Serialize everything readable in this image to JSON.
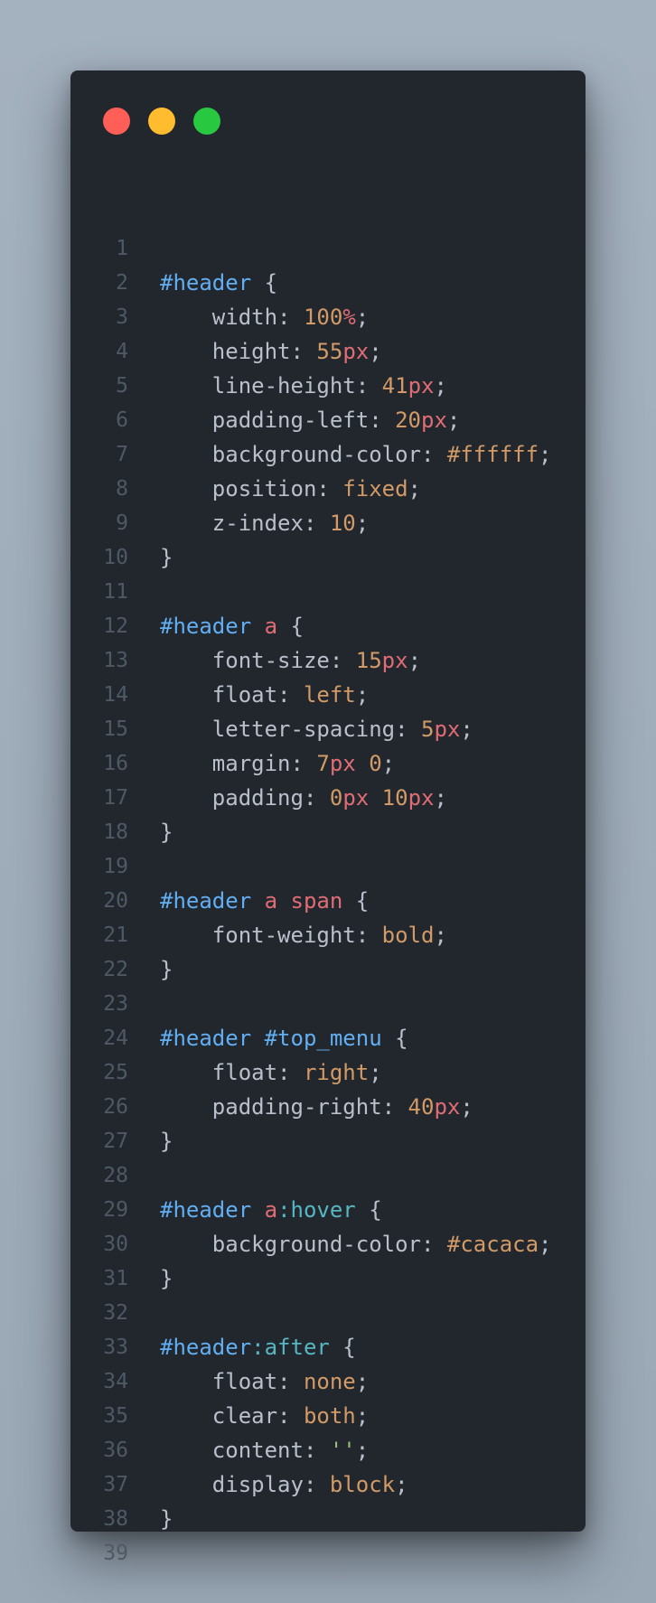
{
  "window": {
    "controls": [
      "close",
      "minimize",
      "maximize"
    ]
  },
  "code": {
    "lines": [
      {
        "n": "1",
        "tokens": []
      },
      {
        "n": "2",
        "tokens": [
          [
            "#header",
            "id"
          ],
          [
            " {",
            "punc"
          ]
        ]
      },
      {
        "n": "3",
        "tokens": [
          [
            "    ",
            "punc"
          ],
          [
            "width",
            "prop"
          ],
          [
            ": ",
            "punc"
          ],
          [
            "100",
            "num"
          ],
          [
            "%",
            "unit"
          ],
          [
            ";",
            "punc"
          ]
        ]
      },
      {
        "n": "4",
        "tokens": [
          [
            "    ",
            "punc"
          ],
          [
            "height",
            "prop"
          ],
          [
            ": ",
            "punc"
          ],
          [
            "55",
            "num"
          ],
          [
            "px",
            "unit"
          ],
          [
            ";",
            "punc"
          ]
        ]
      },
      {
        "n": "5",
        "tokens": [
          [
            "    ",
            "punc"
          ],
          [
            "line-height",
            "prop"
          ],
          [
            ": ",
            "punc"
          ],
          [
            "41",
            "num"
          ],
          [
            "px",
            "unit"
          ],
          [
            ";",
            "punc"
          ]
        ]
      },
      {
        "n": "6",
        "tokens": [
          [
            "    ",
            "punc"
          ],
          [
            "padding-left",
            "prop"
          ],
          [
            ": ",
            "punc"
          ],
          [
            "20",
            "num"
          ],
          [
            "px",
            "unit"
          ],
          [
            ";",
            "punc"
          ]
        ]
      },
      {
        "n": "7",
        "tokens": [
          [
            "    ",
            "punc"
          ],
          [
            "background-color",
            "prop"
          ],
          [
            ": ",
            "punc"
          ],
          [
            "#ffffff",
            "kw"
          ],
          [
            ";",
            "punc"
          ]
        ]
      },
      {
        "n": "8",
        "tokens": [
          [
            "    ",
            "punc"
          ],
          [
            "position",
            "prop"
          ],
          [
            ": ",
            "punc"
          ],
          [
            "fixed",
            "kw"
          ],
          [
            ";",
            "punc"
          ]
        ]
      },
      {
        "n": "9",
        "tokens": [
          [
            "    ",
            "punc"
          ],
          [
            "z-index",
            "prop"
          ],
          [
            ": ",
            "punc"
          ],
          [
            "10",
            "num"
          ],
          [
            ";",
            "punc"
          ]
        ]
      },
      {
        "n": "10",
        "tokens": [
          [
            "}",
            "punc"
          ]
        ]
      },
      {
        "n": "11",
        "tokens": []
      },
      {
        "n": "12",
        "tokens": [
          [
            "#header",
            "id"
          ],
          [
            " ",
            "punc"
          ],
          [
            "a",
            "tag"
          ],
          [
            " {",
            "punc"
          ]
        ]
      },
      {
        "n": "13",
        "tokens": [
          [
            "    ",
            "punc"
          ],
          [
            "font-size",
            "prop"
          ],
          [
            ": ",
            "punc"
          ],
          [
            "15",
            "num"
          ],
          [
            "px",
            "unit"
          ],
          [
            ";",
            "punc"
          ]
        ]
      },
      {
        "n": "14",
        "tokens": [
          [
            "    ",
            "punc"
          ],
          [
            "float",
            "prop"
          ],
          [
            ": ",
            "punc"
          ],
          [
            "left",
            "kw"
          ],
          [
            ";",
            "punc"
          ]
        ]
      },
      {
        "n": "15",
        "tokens": [
          [
            "    ",
            "punc"
          ],
          [
            "letter-spacing",
            "prop"
          ],
          [
            ": ",
            "punc"
          ],
          [
            "5",
            "num"
          ],
          [
            "px",
            "unit"
          ],
          [
            ";",
            "punc"
          ]
        ]
      },
      {
        "n": "16",
        "tokens": [
          [
            "    ",
            "punc"
          ],
          [
            "margin",
            "prop"
          ],
          [
            ": ",
            "punc"
          ],
          [
            "7",
            "num"
          ],
          [
            "px",
            "unit"
          ],
          [
            " ",
            "punc"
          ],
          [
            "0",
            "num"
          ],
          [
            ";",
            "punc"
          ]
        ]
      },
      {
        "n": "17",
        "tokens": [
          [
            "    ",
            "punc"
          ],
          [
            "padding",
            "prop"
          ],
          [
            ": ",
            "punc"
          ],
          [
            "0",
            "num"
          ],
          [
            "px",
            "unit"
          ],
          [
            " ",
            "punc"
          ],
          [
            "10",
            "num"
          ],
          [
            "px",
            "unit"
          ],
          [
            ";",
            "punc"
          ]
        ]
      },
      {
        "n": "18",
        "tokens": [
          [
            "}",
            "punc"
          ]
        ]
      },
      {
        "n": "19",
        "tokens": []
      },
      {
        "n": "20",
        "tokens": [
          [
            "#header",
            "id"
          ],
          [
            " ",
            "punc"
          ],
          [
            "a",
            "tag"
          ],
          [
            " ",
            "punc"
          ],
          [
            "span",
            "tag"
          ],
          [
            " {",
            "punc"
          ]
        ]
      },
      {
        "n": "21",
        "tokens": [
          [
            "    ",
            "punc"
          ],
          [
            "font-weight",
            "prop"
          ],
          [
            ": ",
            "punc"
          ],
          [
            "bold",
            "kw"
          ],
          [
            ";",
            "punc"
          ]
        ]
      },
      {
        "n": "22",
        "tokens": [
          [
            "}",
            "punc"
          ]
        ]
      },
      {
        "n": "23",
        "tokens": []
      },
      {
        "n": "24",
        "tokens": [
          [
            "#header",
            "id"
          ],
          [
            " ",
            "punc"
          ],
          [
            "#top_menu",
            "id"
          ],
          [
            " {",
            "punc"
          ]
        ]
      },
      {
        "n": "25",
        "tokens": [
          [
            "    ",
            "punc"
          ],
          [
            "float",
            "prop"
          ],
          [
            ": ",
            "punc"
          ],
          [
            "right",
            "kw"
          ],
          [
            ";",
            "punc"
          ]
        ]
      },
      {
        "n": "26",
        "tokens": [
          [
            "    ",
            "punc"
          ],
          [
            "padding-right",
            "prop"
          ],
          [
            ": ",
            "punc"
          ],
          [
            "40",
            "num"
          ],
          [
            "px",
            "unit"
          ],
          [
            ";",
            "punc"
          ]
        ]
      },
      {
        "n": "27",
        "tokens": [
          [
            "}",
            "punc"
          ]
        ]
      },
      {
        "n": "28",
        "tokens": []
      },
      {
        "n": "29",
        "tokens": [
          [
            "#header",
            "id"
          ],
          [
            " ",
            "punc"
          ],
          [
            "a",
            "tag"
          ],
          [
            ":hover",
            "pseudo"
          ],
          [
            " {",
            "punc"
          ]
        ]
      },
      {
        "n": "30",
        "tokens": [
          [
            "    ",
            "punc"
          ],
          [
            "background-color",
            "prop"
          ],
          [
            ": ",
            "punc"
          ],
          [
            "#cacaca",
            "kw"
          ],
          [
            ";",
            "punc"
          ]
        ]
      },
      {
        "n": "31",
        "tokens": [
          [
            "}",
            "punc"
          ]
        ]
      },
      {
        "n": "32",
        "tokens": []
      },
      {
        "n": "33",
        "tokens": [
          [
            "#header",
            "id"
          ],
          [
            ":after",
            "pseudo"
          ],
          [
            " {",
            "punc"
          ]
        ]
      },
      {
        "n": "34",
        "tokens": [
          [
            "    ",
            "punc"
          ],
          [
            "float",
            "prop"
          ],
          [
            ": ",
            "punc"
          ],
          [
            "none",
            "kw"
          ],
          [
            ";",
            "punc"
          ]
        ]
      },
      {
        "n": "35",
        "tokens": [
          [
            "    ",
            "punc"
          ],
          [
            "clear",
            "prop"
          ],
          [
            ": ",
            "punc"
          ],
          [
            "both",
            "kw"
          ],
          [
            ";",
            "punc"
          ]
        ]
      },
      {
        "n": "36",
        "tokens": [
          [
            "    ",
            "punc"
          ],
          [
            "content",
            "prop"
          ],
          [
            ": ",
            "punc"
          ],
          [
            "''",
            "str"
          ],
          [
            ";",
            "punc"
          ]
        ]
      },
      {
        "n": "37",
        "tokens": [
          [
            "    ",
            "punc"
          ],
          [
            "display",
            "prop"
          ],
          [
            ": ",
            "punc"
          ],
          [
            "block",
            "kw"
          ],
          [
            ";",
            "punc"
          ]
        ]
      },
      {
        "n": "38",
        "tokens": [
          [
            "}",
            "punc"
          ]
        ]
      },
      {
        "n": "39",
        "tokens": []
      }
    ]
  }
}
